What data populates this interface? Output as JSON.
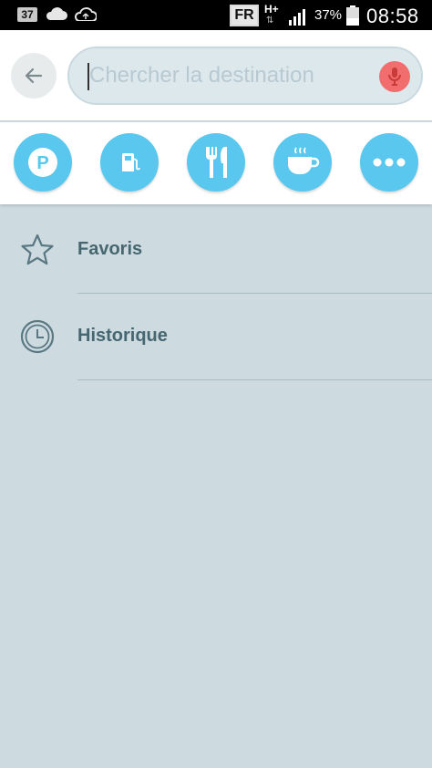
{
  "status_bar": {
    "notification_count": "37",
    "language": "FR",
    "network": "H+",
    "network_arrows": "⇅",
    "battery_percent": "37%",
    "time": "08:58"
  },
  "search": {
    "placeholder": "Chercher la destination",
    "value": ""
  },
  "categories": [
    {
      "name": "parking",
      "icon": "parking-icon"
    },
    {
      "name": "gas-station",
      "icon": "gas-pump-icon"
    },
    {
      "name": "food",
      "icon": "fork-knife-icon"
    },
    {
      "name": "coffee",
      "icon": "coffee-cup-icon"
    },
    {
      "name": "more",
      "icon": "more-dots-icon"
    }
  ],
  "list": {
    "favorites_label": "Favoris",
    "history_label": "Historique"
  },
  "colors": {
    "accent": "#5ac8ee",
    "background": "#cddbe1",
    "mic": "#f26d6d",
    "label": "#466670"
  }
}
